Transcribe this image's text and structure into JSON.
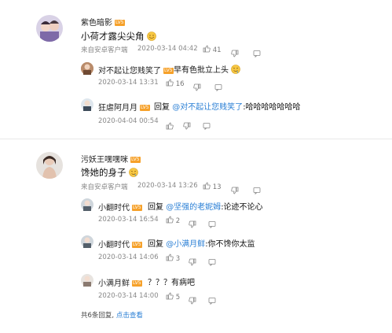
{
  "comments": [
    {
      "user": "紫色暗影",
      "level": "LV5",
      "text": "小荷才露尖尖角",
      "source": "来自安卓客户端",
      "date": "2020-03-14 04:42",
      "likes": "41",
      "replies": [
        {
          "user": "对不起让您贱笑了",
          "level": "LV5",
          "text": "早有色批立上头",
          "date": "2020-03-14 13:31",
          "likes": "16"
        },
        {
          "user": "狂虐阿月月",
          "level": "LV5",
          "reply_word": "回复",
          "mention": "@对不起让您贱笑了",
          "text": ":哈哈哈哈哈哈哈",
          "date": "2020-04-04 00:54"
        }
      ]
    },
    {
      "user": "污妖王嘿嘿咪",
      "level": "LV5",
      "text": "馋她的身子",
      "source": "来自安卓客户端",
      "date": "2020-03-14 13:26",
      "likes": "13",
      "replies": [
        {
          "user": "小翻时代",
          "level": "LV5",
          "reply_word": "回复",
          "mention": "@坚强的老妮姆",
          "text": ":论迹不论心",
          "date": "2020-03-14 16:54",
          "likes": "2"
        },
        {
          "user": "小翻时代",
          "level": "LV5",
          "reply_word": "回复",
          "mention": "@小满月鲜",
          "text": ":你不馋你太监",
          "date": "2020-03-14 14:06",
          "likes": "3"
        },
        {
          "user": "小满月鲜",
          "level": "LV5",
          "text": "？？？有病吧",
          "date": "2020-03-14 14:00",
          "likes": "5"
        }
      ]
    }
  ],
  "footer": {
    "total": "共6条回复,",
    "more_link": "点击查看"
  },
  "colors": {
    "link": "#2a7fd5",
    "level_badge": "#f6a12a"
  }
}
